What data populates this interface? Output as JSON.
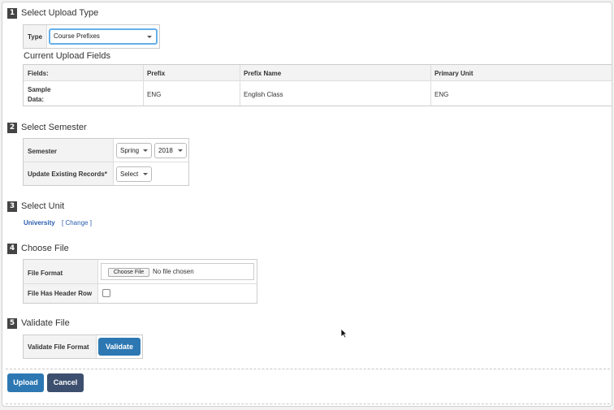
{
  "steps": [
    {
      "number": "1",
      "title": "Select Upload Type"
    },
    {
      "number": "2",
      "title": "Select Semester"
    },
    {
      "number": "3",
      "title": "Select Unit"
    },
    {
      "number": "4",
      "title": "Choose File"
    },
    {
      "number": "5",
      "title": "Validate File"
    }
  ],
  "upload_type": {
    "label": "Type",
    "selected": "Course Prefixes",
    "fields_heading": "Current Upload Fields",
    "table": {
      "headers": [
        "Fields:",
        "Prefix",
        "Prefix Name",
        "Primary Unit"
      ],
      "sample_label_line1": "Sample",
      "sample_label_line2": "Data:",
      "sample_values": [
        "ENG",
        "English Class",
        "ENG"
      ]
    }
  },
  "semester": {
    "label": "Semester",
    "term": "Spring",
    "year": "2018",
    "update_label": "Update Existing Records*",
    "update_selected": "Select"
  },
  "unit": {
    "name": "University",
    "change_label": "[ Change ]"
  },
  "file": {
    "format_label": "File Format",
    "choose_button": "Choose File",
    "no_file": "No file chosen",
    "header_row_label": "File Has Header Row"
  },
  "validate": {
    "label": "Validate File Format",
    "button": "Validate"
  },
  "actions": {
    "upload": "Upload",
    "cancel": "Cancel"
  },
  "colors": {
    "primary_button": "#2d78b3",
    "cancel_button": "#3d4f6e",
    "focus_border": "#66afe9",
    "link": "#2a5db0"
  }
}
